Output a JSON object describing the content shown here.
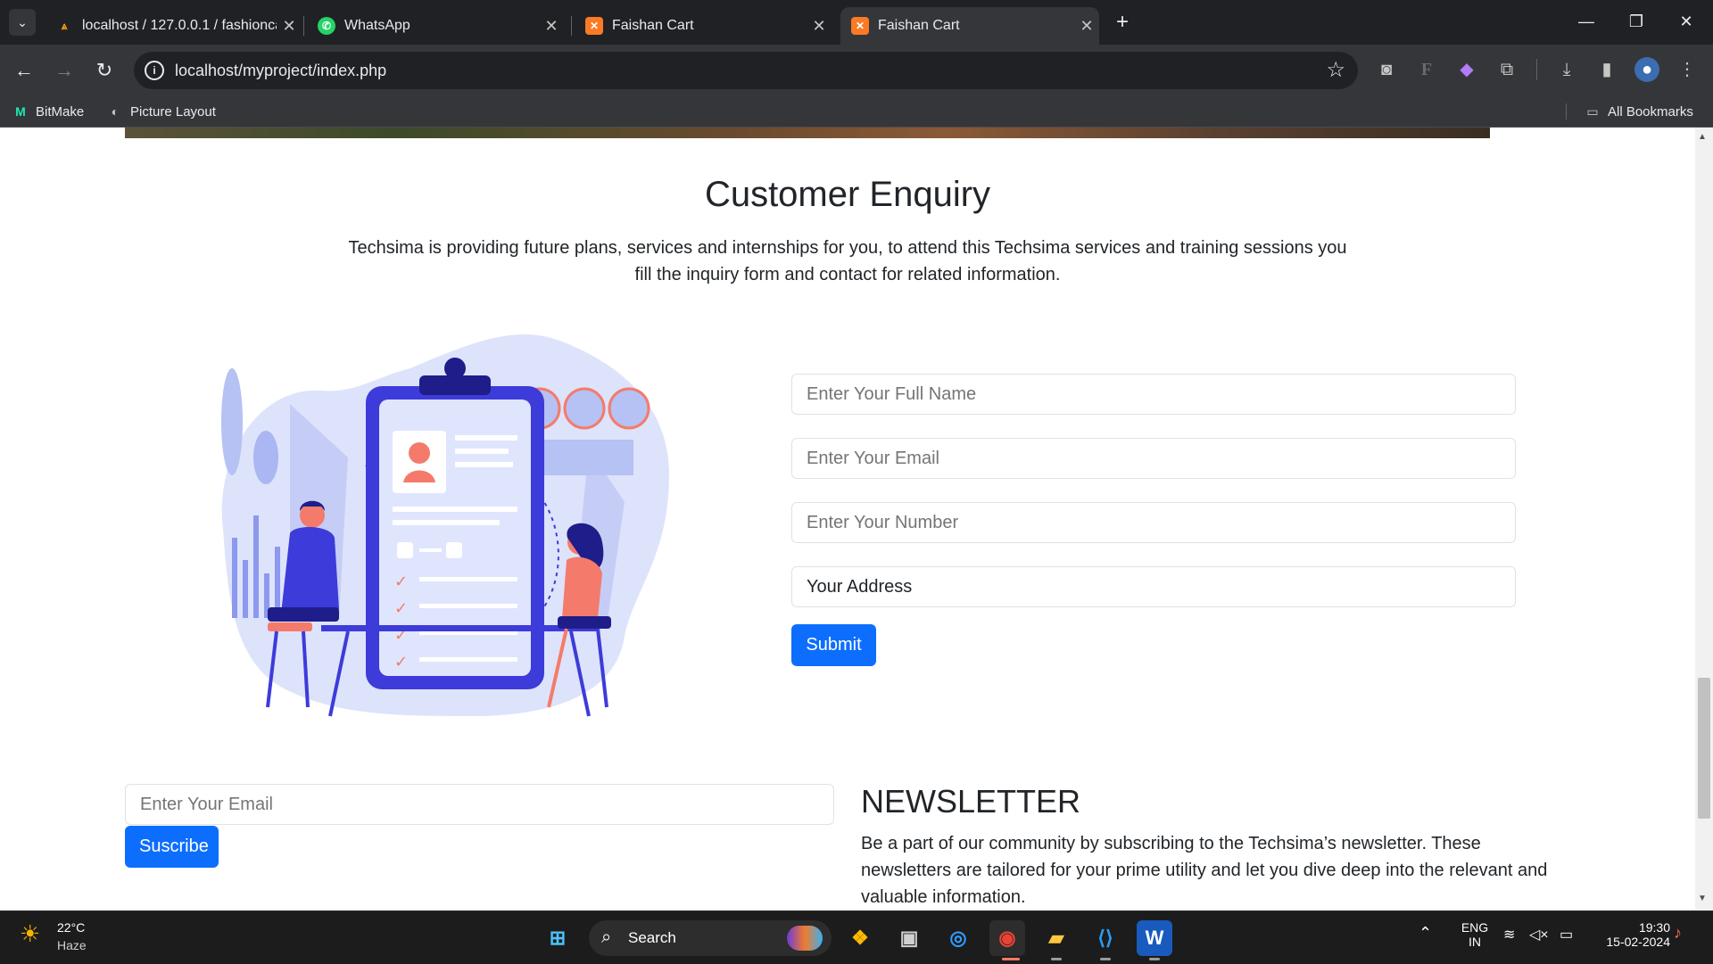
{
  "browser": {
    "tabs": [
      {
        "label": "localhost / 127.0.0.1 / fashionca",
        "favicon": "phpmyadmin-icon",
        "active": false
      },
      {
        "label": "WhatsApp",
        "favicon": "whatsapp-icon",
        "active": false
      },
      {
        "label": "Faishan Cart",
        "favicon": "xampp-icon",
        "active": false
      },
      {
        "label": "Faishan Cart",
        "favicon": "xampp-icon",
        "active": true
      }
    ],
    "url": "localhost/myproject/index.php",
    "bookmarks": [
      {
        "label": "BitMake",
        "icon": "bitmake-icon"
      },
      {
        "label": "Picture Layout",
        "icon": "picture-layout-icon"
      }
    ],
    "all_bookmarks": "All Bookmarks"
  },
  "enquiry": {
    "title": "Customer Enquiry",
    "description": "Techsima is providing future plans, services and internships for you, to attend this Techsima services and training sessions you fill the inquiry form and contact for related information.",
    "fields": {
      "name_placeholder": "Enter Your Full Name",
      "email_placeholder": "Enter Your Email",
      "number_placeholder": "Enter Your Number",
      "address_value": "Your Address"
    },
    "submit_label": "Submit"
  },
  "newsletter": {
    "email_placeholder": "Enter Your Email",
    "button_label": "Suscribe",
    "title": "NEWSLETTER",
    "description": "Be a part of our community by subscribing to the Techsima’s newsletter. These newsletters are tailored for your prime utility and let you dive deep into the relevant and valuable information."
  },
  "taskbar": {
    "weather_temp": "22°C",
    "weather_desc": "Haze",
    "search_label": "Search",
    "lang_top": "ENG",
    "lang_bottom": "IN",
    "time": "19:30",
    "date": "15-02-2024"
  },
  "colors": {
    "primary": "#0d6efd",
    "illustration_blue": "#3d3bd9",
    "illustration_coral": "#f47b6b"
  }
}
